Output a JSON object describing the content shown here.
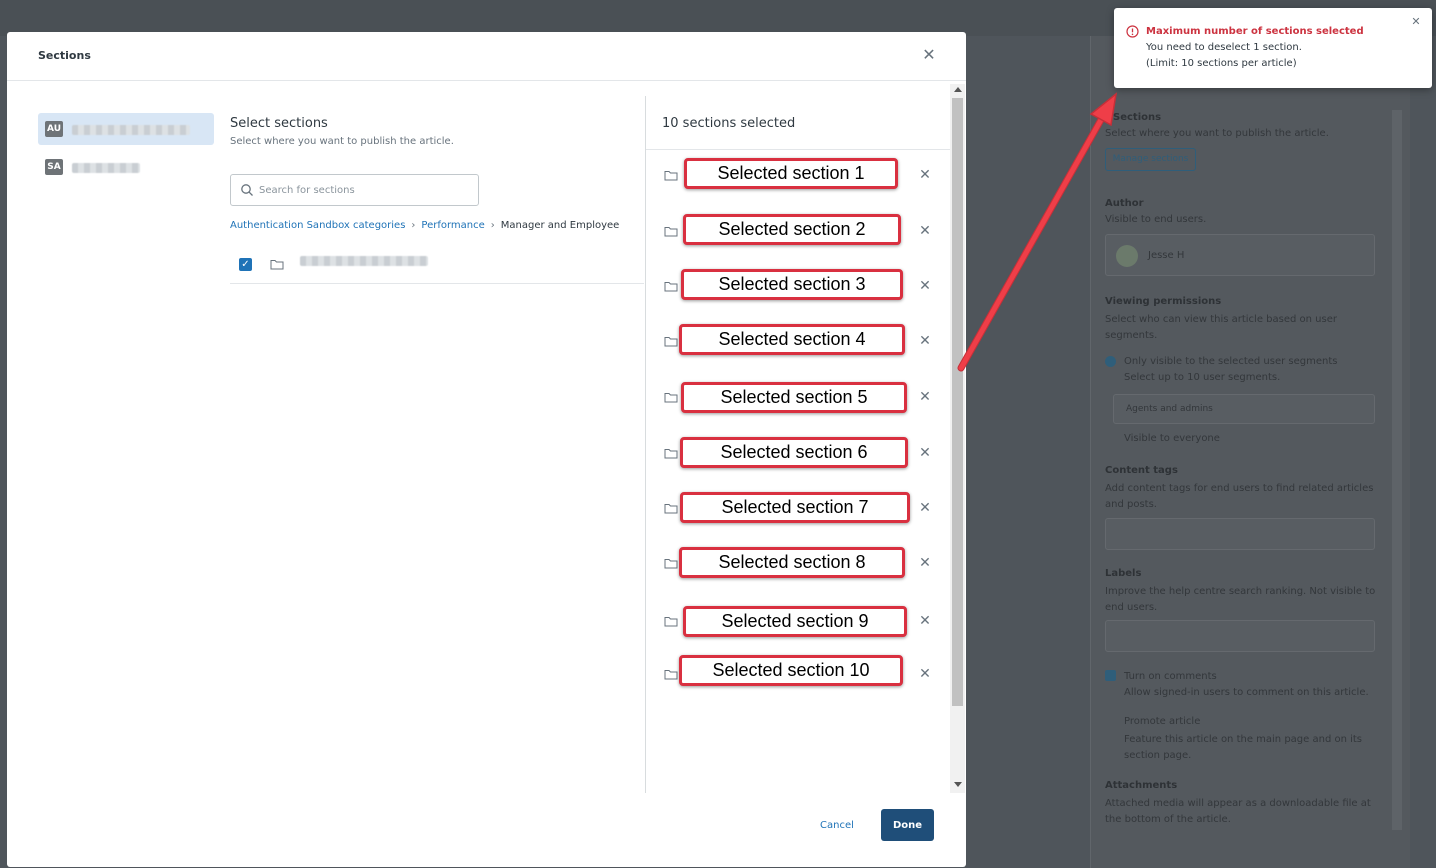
{
  "background_panel": {
    "sections_heading": "Sections",
    "sections_sub": "Select where you want to publish the article.",
    "manage_sections": "Manage sections",
    "author_heading": "Author",
    "author_sub": "Visible to end users.",
    "author_name": "Jesse H",
    "viewing_heading": "Viewing permissions",
    "viewing_sub": "Select who can view this article based on user segments.",
    "only_visible": "Only visible to the selected user segments",
    "select_up_to": "Select up to 10 user segments.",
    "segment_tag": "Agents and admins",
    "visible_everyone": "Visible to everyone",
    "content_tags_heading": "Content tags",
    "content_tags_sub": "Add content tags for end users to find related articles and posts.",
    "labels_heading": "Labels",
    "labels_sub": "Improve the help centre search ranking. Not visible to end users.",
    "comments_label": "Turn on comments",
    "comments_sub": "Allow signed-in users to comment on this article.",
    "promote_label": "Promote article",
    "promote_sub": "Feature this article on the main page and on its section page.",
    "attachments_heading": "Attachments",
    "attachments_sub": "Attached media will appear as a downloadable file at the bottom of the article."
  },
  "modal": {
    "title": "Sections",
    "brands": [
      {
        "badge": "AU"
      },
      {
        "badge": "SA"
      }
    ],
    "select_heading": "Select sections",
    "select_sub": "Select where you want to publish the article.",
    "search_placeholder": "Search for sections",
    "breadcrumb": [
      "Authentication Sandbox categories",
      "Performance",
      "Manager and Employee"
    ],
    "selected_count": "10 sections selected",
    "selected_sections": [
      "Selected section 1",
      "Selected section 2",
      "Selected section 3",
      "Selected section 4",
      "Selected section 5",
      "Selected section 6",
      "Selected section 7",
      "Selected section 8",
      "Selected section 9",
      "Selected section 10"
    ],
    "cancel_label": "Cancel",
    "done_label": "Done"
  },
  "toast": {
    "title": "Maximum number of sections selected",
    "line1": "You need to deselect 1 section.",
    "line2": "(Limit: 10 sections per article)"
  },
  "colors": {
    "accent": "#1f73b7",
    "danger": "#cc3340",
    "annotation": "#e8343f"
  }
}
